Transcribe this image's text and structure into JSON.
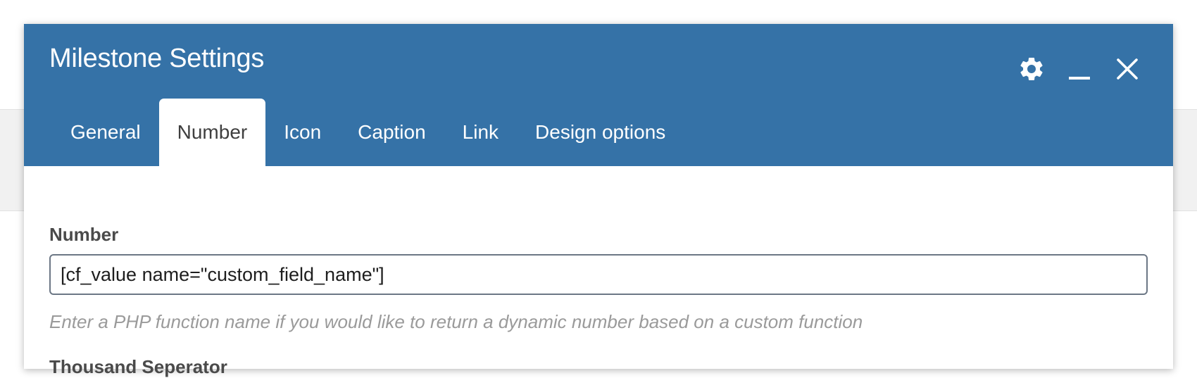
{
  "modal": {
    "title": "Milestone Settings",
    "controls": {
      "settings_icon": "gear-icon",
      "minimize_icon": "minimize-icon",
      "close_icon": "close-icon"
    }
  },
  "tabs": [
    {
      "label": "General",
      "active": false
    },
    {
      "label": "Number",
      "active": true
    },
    {
      "label": "Icon",
      "active": false
    },
    {
      "label": "Caption",
      "active": false
    },
    {
      "label": "Link",
      "active": false
    },
    {
      "label": "Design options",
      "active": false
    }
  ],
  "fields": {
    "number": {
      "label": "Number",
      "value": "[cf_value name=\"custom_field_name\"]",
      "hint": "Enter a PHP function name if you would like to return a dynamic number based on a custom function"
    },
    "thousand_separator": {
      "label": "Thousand Seperator"
    }
  },
  "colors": {
    "header_bg": "#3572a7",
    "header_text": "#ffffff",
    "label_text": "#4a4a4a",
    "hint_text": "#9a9a9a",
    "input_border": "#6c7785"
  }
}
